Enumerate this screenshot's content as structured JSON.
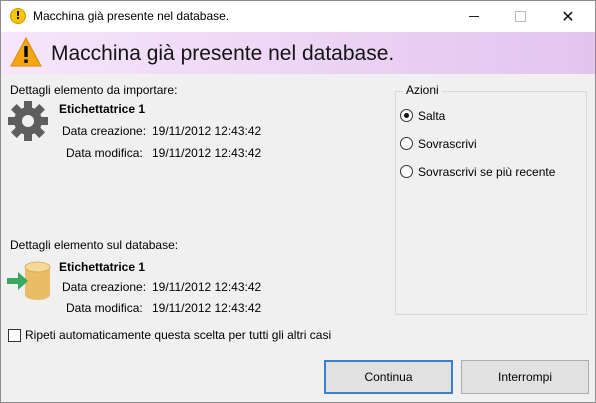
{
  "window": {
    "title": "Macchina già presente nel database.",
    "controls": {
      "minimize_icon": "minimize-icon",
      "maximize_icon": "maximize-icon",
      "close_glyph": "✕"
    }
  },
  "banner": {
    "icon": "warning-icon",
    "title": "Macchina già presente nel database."
  },
  "import_section": {
    "label": "Dettagli elemento da importare:",
    "icon": "gear-icon",
    "name": "Etichettatrice 1",
    "created_label": "Data creazione:",
    "created_value": "19/11/2012 12:43:42",
    "modified_label": "Data modifica:",
    "modified_value": "19/11/2012 12:43:42"
  },
  "database_section": {
    "label": "Dettagli elemento sul database:",
    "icon": "database-import-icon",
    "name": "Etichettatrice 1",
    "created_label": "Data creazione:",
    "created_value": "19/11/2012 12:43:42",
    "modified_label": "Data modifica:",
    "modified_value": "19/11/2012 12:43:42"
  },
  "actions": {
    "legend": "Azioni",
    "options": [
      {
        "label": "Salta",
        "checked": true
      },
      {
        "label": "Sovrascrivi",
        "checked": false
      },
      {
        "label": "Sovrascrivi se più recente",
        "checked": false
      }
    ]
  },
  "repeat_checkbox": {
    "label": "Ripeti automaticamente questa scelta per tutti gli altri casi",
    "checked": false
  },
  "buttons": {
    "continue": "Continua",
    "stop": "Interrompi"
  },
  "colors": {
    "banner_start": "#f6e6fb",
    "banner_end": "#e3c4ef",
    "warning": "#f3a712",
    "default_button_border": "#3c7fd1"
  }
}
